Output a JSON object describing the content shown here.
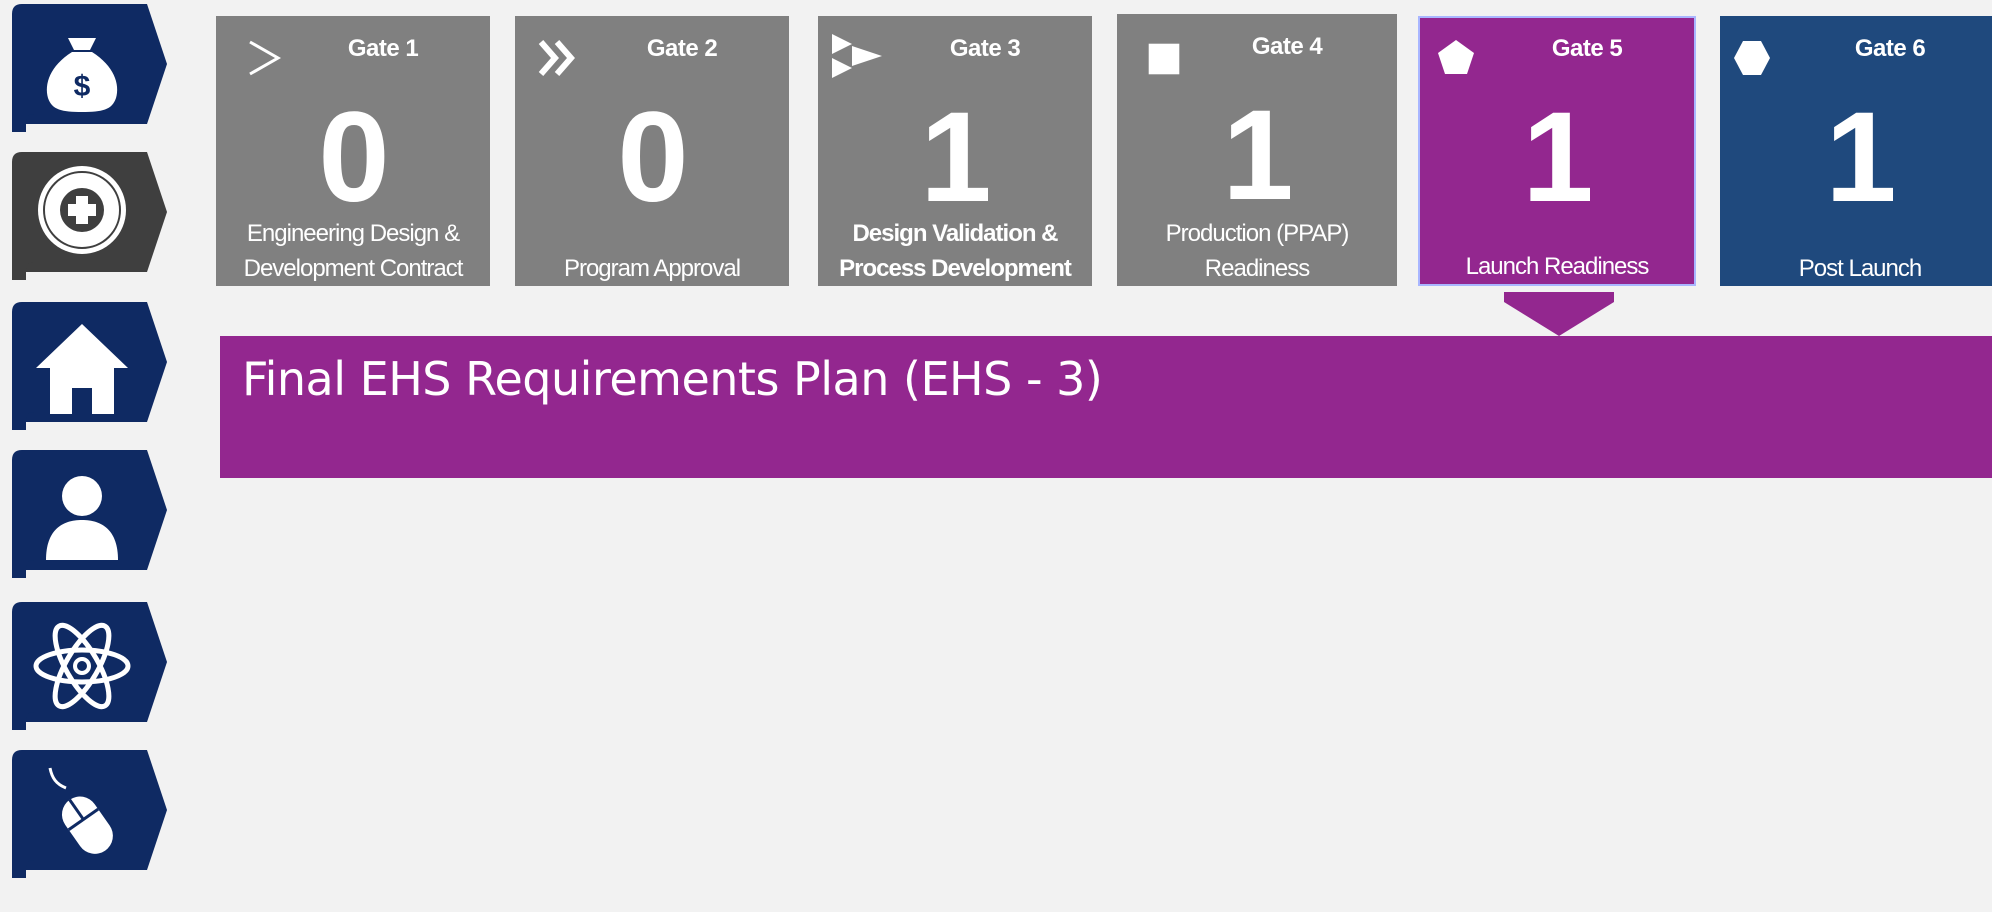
{
  "colors": {
    "nav_navy": "#0f2a63",
    "nav_selected": "#3f3f3f",
    "gate_gray": "#808080",
    "gate_active": "#93278f",
    "gate_dark": "#1f497d",
    "banner": "#93278f",
    "background": "#f2f2f2"
  },
  "sidebar": {
    "items": [
      {
        "icon": "money-bag-icon",
        "selected": false
      },
      {
        "icon": "medical-cross-icon",
        "selected": true
      },
      {
        "icon": "home-icon",
        "selected": false
      },
      {
        "icon": "person-icon",
        "selected": false
      },
      {
        "icon": "atom-icon",
        "selected": false
      },
      {
        "icon": "mouse-icon",
        "selected": false
      }
    ]
  },
  "gates": [
    {
      "label": "Gate 1",
      "count": "0",
      "desc_line1": "Engineering Design &",
      "desc_line2": "Development Contract",
      "symbol": "chevron-icon",
      "state": "inactive"
    },
    {
      "label": "Gate 2",
      "count": "0",
      "desc_line1": "",
      "desc_line2": "Program Approval",
      "symbol": "double-chevron-icon",
      "state": "inactive"
    },
    {
      "label": "Gate 3",
      "count": "1",
      "desc_line1": "Design Validation &",
      "desc_line2": "Process Development",
      "symbol": "flag-triangles-icon",
      "state": "inactive"
    },
    {
      "label": "Gate 4",
      "count": "1",
      "desc_line1": "Production (PPAP)",
      "desc_line2": "Readiness",
      "symbol": "square-icon",
      "state": "inactive"
    },
    {
      "label": "Gate 5",
      "count": "1",
      "desc_line1": "",
      "desc_line2": "Launch Readiness",
      "symbol": "pentagon-icon",
      "state": "active"
    },
    {
      "label": "Gate 6",
      "count": "1",
      "desc_line1": "",
      "desc_line2": "Post Launch",
      "symbol": "hexagon-icon",
      "state": "dark"
    }
  ],
  "banner": {
    "title": "Final EHS Requirements Plan (EHS - 3)"
  }
}
